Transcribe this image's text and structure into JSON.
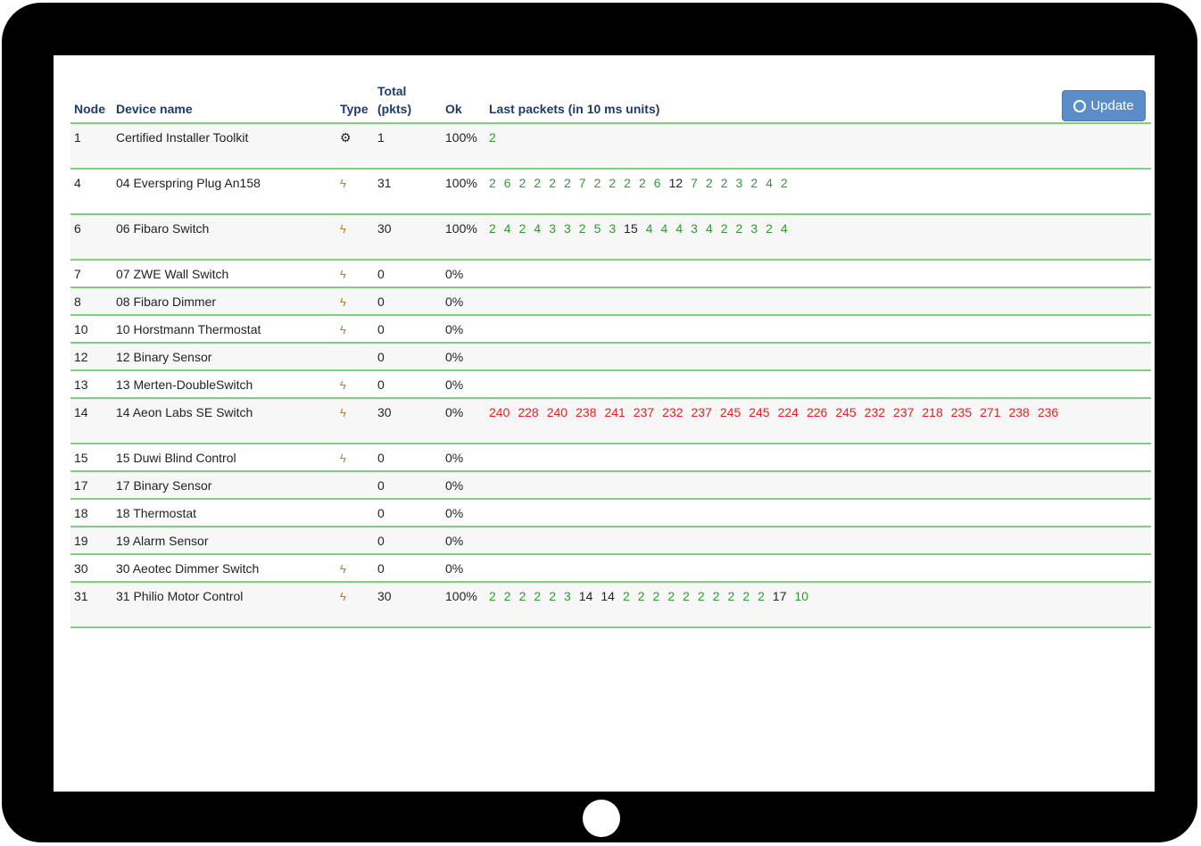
{
  "update_label": "Update",
  "columns": {
    "node": "Node",
    "name": "Device name",
    "type": "Type",
    "total_line1": "Total",
    "total_line2": "(pkts)",
    "ok": "Ok",
    "packets": "Last packets (in 10 ms units)"
  },
  "colors": {
    "good": "#2f9a2f",
    "neutral": "#222222",
    "bad": "#e32222",
    "rule": "#7fcf7f",
    "header": "#1f3a6b"
  },
  "rows": [
    {
      "node": "1",
      "name": "Certified Installer Toolkit",
      "type": "gear-icon",
      "total": "1",
      "ok": "100%",
      "packets": [
        "2"
      ],
      "packet_class": [
        "good"
      ]
    },
    {
      "node": "4",
      "name": "04 Everspring Plug An158",
      "type": "power-icon",
      "total": "31",
      "ok": "100%",
      "packets": [
        "2",
        "6",
        "2",
        "2",
        "2",
        "2",
        "7",
        "2",
        "2",
        "2",
        "2",
        "6",
        "12",
        "7",
        "2",
        "2",
        "3",
        "2",
        "4",
        "2"
      ],
      "packet_class": [
        "good",
        "good",
        "good",
        "good",
        "good",
        "good",
        "good",
        "good",
        "good",
        "good",
        "good",
        "good",
        "neutral",
        "good",
        "good",
        "good",
        "good",
        "good",
        "good",
        "good"
      ]
    },
    {
      "node": "6",
      "name": "06 Fibaro Switch",
      "type": "power-icon",
      "total": "30",
      "ok": "100%",
      "packets": [
        "2",
        "4",
        "2",
        "4",
        "3",
        "3",
        "2",
        "5",
        "3",
        "15",
        "4",
        "4",
        "4",
        "3",
        "4",
        "2",
        "2",
        "3",
        "2",
        "4"
      ],
      "packet_class": [
        "good",
        "good",
        "good",
        "good",
        "good",
        "good",
        "good",
        "good",
        "good",
        "neutral",
        "good",
        "good",
        "good",
        "good",
        "good",
        "good",
        "good",
        "good",
        "good",
        "good"
      ]
    },
    {
      "node": "7",
      "name": "07 ZWE Wall Switch",
      "type": "power-icon",
      "total": "0",
      "ok": "0%",
      "packets": [],
      "packet_class": []
    },
    {
      "node": "8",
      "name": "08 Fibaro Dimmer",
      "type": "power-icon",
      "total": "0",
      "ok": "0%",
      "packets": [],
      "packet_class": []
    },
    {
      "node": "10",
      "name": "10 Horstmann Thermostat",
      "type": "power-icon",
      "total": "0",
      "ok": "0%",
      "packets": [],
      "packet_class": []
    },
    {
      "node": "12",
      "name": "12 Binary Sensor",
      "type": "",
      "total": "0",
      "ok": "0%",
      "packets": [],
      "packet_class": []
    },
    {
      "node": "13",
      "name": "13 Merten-DoubleSwitch",
      "type": "power-icon",
      "total": "0",
      "ok": "0%",
      "packets": [],
      "packet_class": []
    },
    {
      "node": "14",
      "name": "14 Aeon Labs SE Switch",
      "type": "power-icon",
      "total": "30",
      "ok": "0%",
      "packets": [
        "240",
        "228",
        "240",
        "238",
        "241",
        "237",
        "232",
        "237",
        "245",
        "245",
        "224",
        "226",
        "245",
        "232",
        "237",
        "218",
        "235",
        "271",
        "238",
        "236"
      ],
      "packet_class": [
        "bad",
        "bad",
        "bad",
        "bad",
        "bad",
        "bad",
        "bad",
        "bad",
        "bad",
        "bad",
        "bad",
        "bad",
        "bad",
        "bad",
        "bad",
        "bad",
        "bad",
        "bad",
        "bad",
        "bad"
      ]
    },
    {
      "node": "15",
      "name": "15 Duwi Blind Control",
      "type": "power-icon",
      "total": "0",
      "ok": "0%",
      "packets": [],
      "packet_class": []
    },
    {
      "node": "17",
      "name": "17 Binary Sensor",
      "type": "",
      "total": "0",
      "ok": "0%",
      "packets": [],
      "packet_class": []
    },
    {
      "node": "18",
      "name": "18 Thermostat",
      "type": "",
      "total": "0",
      "ok": "0%",
      "packets": [],
      "packet_class": []
    },
    {
      "node": "19",
      "name": "19 Alarm Sensor",
      "type": "",
      "total": "0",
      "ok": "0%",
      "packets": [],
      "packet_class": []
    },
    {
      "node": "30",
      "name": "30 Aeotec Dimmer Switch",
      "type": "power-icon",
      "total": "0",
      "ok": "0%",
      "packets": [],
      "packet_class": []
    },
    {
      "node": "31",
      "name": "31 Philio Motor Control",
      "type": "power-icon",
      "total": "30",
      "ok": "100%",
      "packets": [
        "2",
        "2",
        "2",
        "2",
        "2",
        "3",
        "14",
        "14",
        "2",
        "2",
        "2",
        "2",
        "2",
        "2",
        "2",
        "2",
        "2",
        "2",
        "17",
        "10"
      ],
      "packet_class": [
        "good",
        "good",
        "good",
        "good",
        "good",
        "good",
        "neutral",
        "neutral",
        "good",
        "good",
        "good",
        "good",
        "good",
        "good",
        "good",
        "good",
        "good",
        "good",
        "neutral",
        "good"
      ]
    }
  ]
}
